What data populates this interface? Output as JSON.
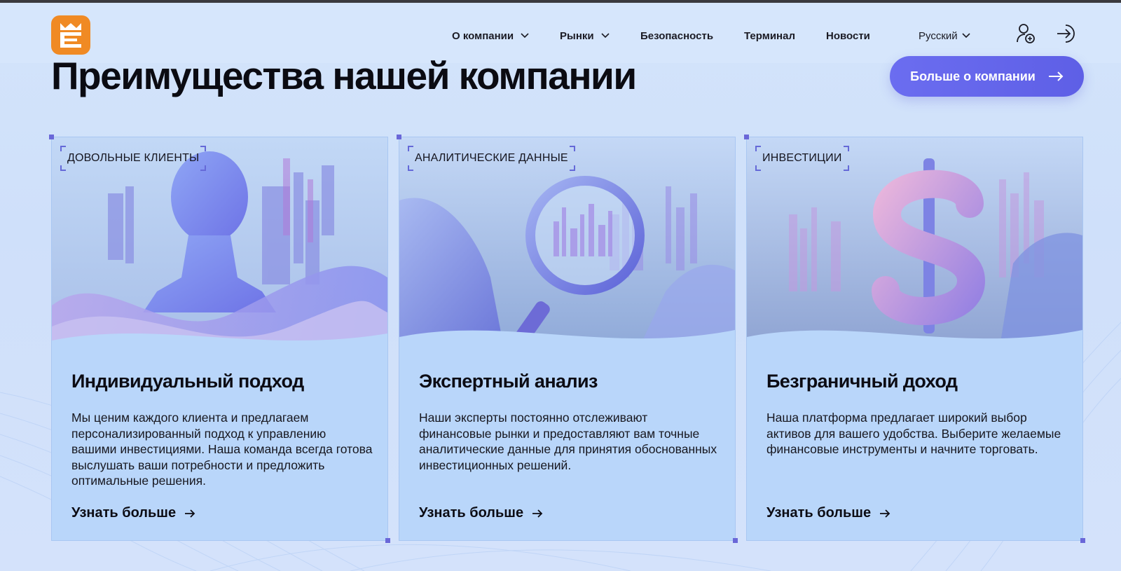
{
  "header": {
    "logo_icon": "crown-e-logo-icon",
    "nav": [
      {
        "label": "О компании",
        "has_dropdown": true
      },
      {
        "label": "Рынки",
        "has_dropdown": true
      },
      {
        "label": "Безопасность",
        "has_dropdown": false
      },
      {
        "label": "Терминал",
        "has_dropdown": false
      },
      {
        "label": "Новости",
        "has_dropdown": false
      }
    ],
    "language": "Русский",
    "register_icon": "user-add-icon",
    "login_icon": "login-arrow-icon"
  },
  "hero": {
    "title": "Преимущества нашей компании",
    "cta_label": "Больше о компании"
  },
  "cards": [
    {
      "badge": "ДОВОЛЬНЫЕ КЛИЕНТЫ",
      "title": "Индивидуальный подход",
      "text": "Мы ценим каждого клиента и предлагаем персонализированный подход к управлению вашими инвестициями. Наша команда всегда готова выслушать ваши потребности и предложить оптимальные решения.",
      "link": "Узнать больше",
      "illustration": "bust-illustration"
    },
    {
      "badge": "АНАЛИТИЧЕСКИЕ ДАННЫЕ",
      "title": "Экспертный анализ",
      "text": "Наши эксперты постоянно отслеживают финансовые рынки и предоставляют вам точные аналитические данные для принятия обоснованных инвестиционных решений.",
      "link": "Узнать больше",
      "illustration": "magnifier-illustration"
    },
    {
      "badge": "ИНВЕСТИЦИИ",
      "title": "Безграничный доход",
      "text": "Наша платформа предлагает широкий выбор активов для вашего удобства. Выберите желаемые финансовые инструменты и начните торговать.",
      "link": "Узнать больше",
      "illustration": "dollar-illustration"
    }
  ],
  "colors": {
    "accent": "#6466ea",
    "logo": "#f08a24",
    "card": "#b9d6fa",
    "page": "#d3e4fb"
  }
}
